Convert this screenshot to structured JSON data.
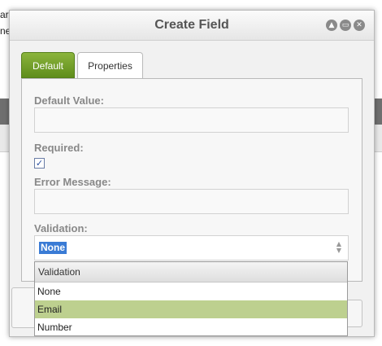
{
  "background": {
    "fragment_1": "ar",
    "fragment_2": "ne"
  },
  "dialog": {
    "title": "Create Field",
    "window_buttons": [
      "▲",
      "▭",
      "✕"
    ]
  },
  "tabs": [
    {
      "label": "Default",
      "active": false
    },
    {
      "label": "Properties",
      "active": true
    }
  ],
  "form": {
    "default_value_label": "Default Value:",
    "default_value": "",
    "required_label": "Required:",
    "required_checked": true,
    "error_message_label": "Error Message:",
    "error_message": "",
    "validation_label": "Validation:",
    "validation_value": "None"
  },
  "dropdown": {
    "header": "Validation",
    "options": [
      {
        "label": "None",
        "highlighted": false
      },
      {
        "label": "Email",
        "highlighted": true
      },
      {
        "label": "Number",
        "highlighted": false
      }
    ]
  },
  "colors": {
    "tab_active_green": "#6e9c26",
    "highlight_row": "#bdd08f",
    "selection_blue": "#3a7bd5"
  }
}
